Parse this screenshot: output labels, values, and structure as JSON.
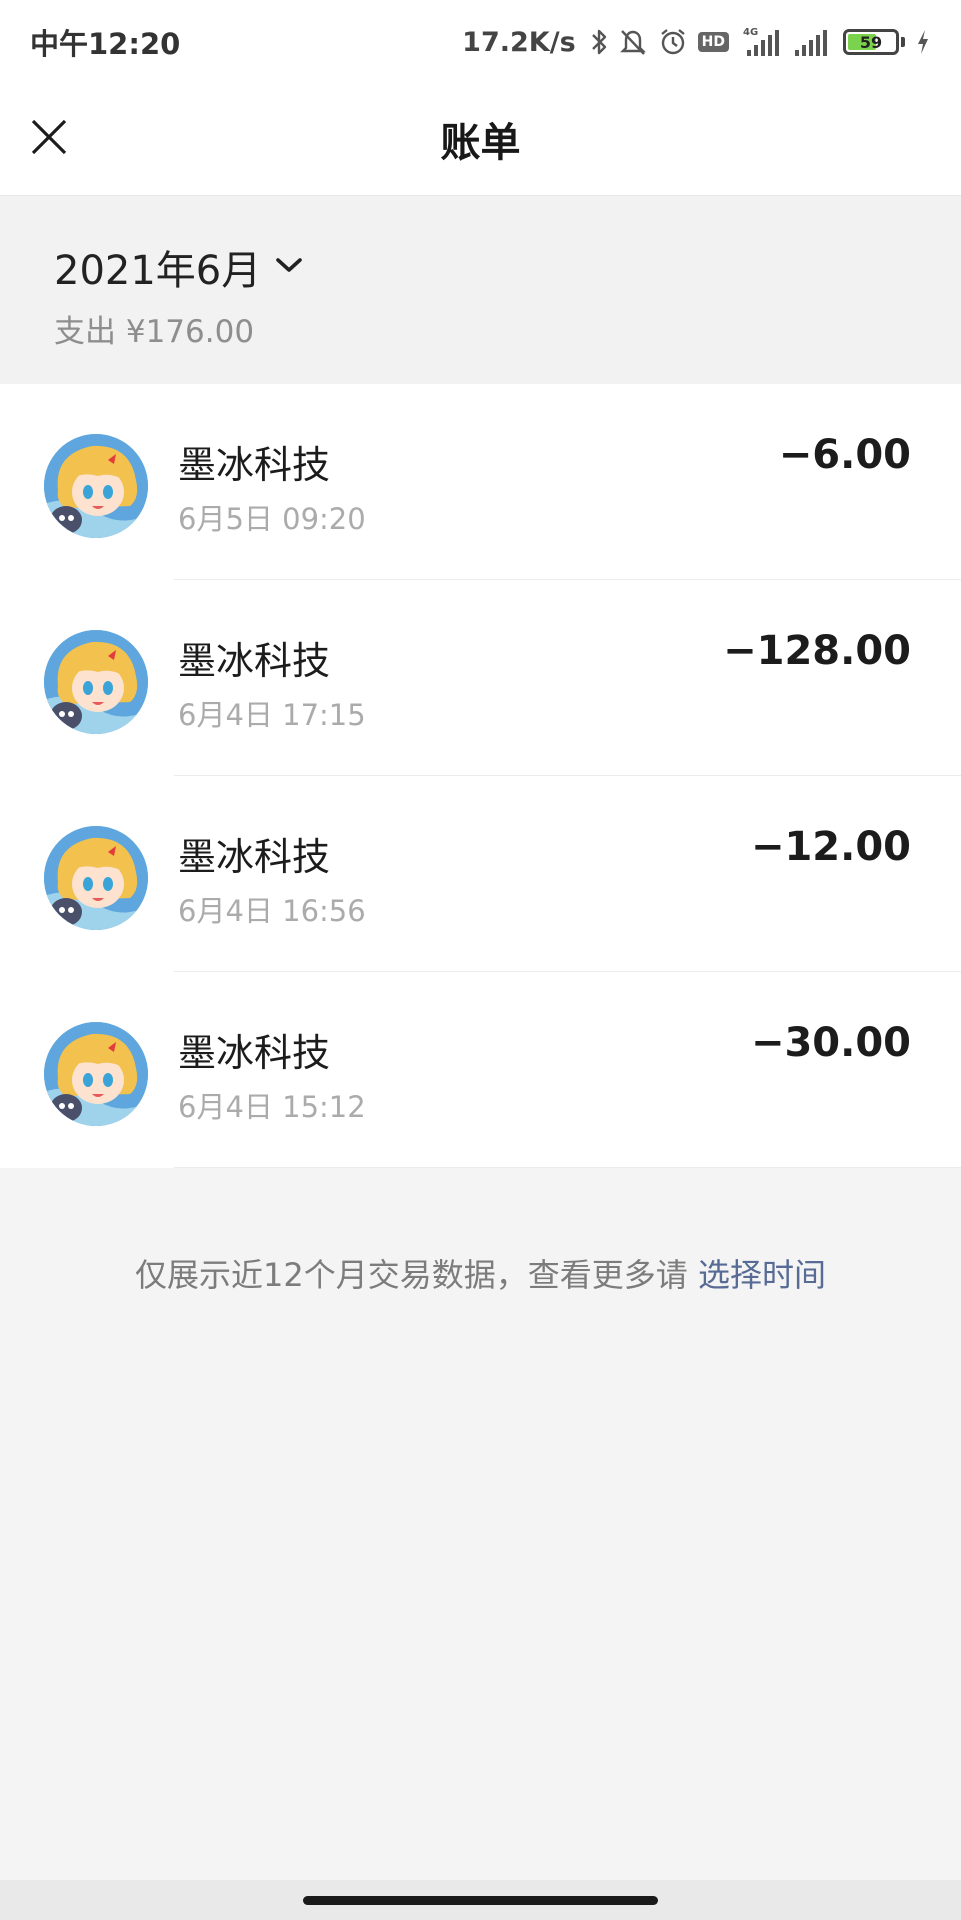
{
  "status_bar": {
    "time": "中午12:20",
    "net_speed": "17.2K/s",
    "hd": "HD",
    "network": "4G",
    "battery": "59",
    "battery_level": 0.59,
    "icons": [
      "bluetooth-icon",
      "mute-bell-icon",
      "alarm-icon",
      "hd-icon",
      "signal-4g-icon",
      "signal-icon",
      "battery-icon",
      "charging-icon"
    ]
  },
  "header": {
    "title": "账单",
    "close_icon": "close-icon"
  },
  "month": {
    "label": "2021年6月",
    "summary": "支出 ¥176.00",
    "dropdown_icon": "chevron-down-icon"
  },
  "transactions": [
    {
      "name": "墨冰科技",
      "time": "6月5日 09:20",
      "amount": "−6.00"
    },
    {
      "name": "墨冰科技",
      "time": "6月4日 17:15",
      "amount": "−128.00"
    },
    {
      "name": "墨冰科技",
      "time": "6月4日 16:56",
      "amount": "−12.00"
    },
    {
      "name": "墨冰科技",
      "time": "6月4日 15:12",
      "amount": "−30.00"
    }
  ],
  "footer": {
    "note": "仅展示近12个月交易数据，查看更多请 ",
    "link": "选择时间"
  },
  "colors": {
    "link": "#576b95",
    "background": "#f4f4f4",
    "battery_fill": "#7bd24d"
  }
}
